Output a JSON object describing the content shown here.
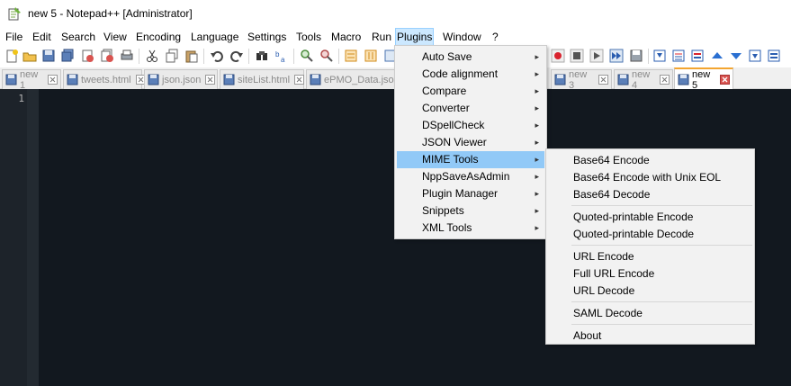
{
  "window": {
    "title": "new 5 - Notepad++ [Administrator]"
  },
  "menubar": {
    "file": "File",
    "edit": "Edit",
    "search": "Search",
    "view": "View",
    "encoding": "Encoding",
    "language": "Language",
    "settings": "Settings",
    "tools": "Tools",
    "macro": "Macro",
    "run": "Run",
    "plugins": "Plugins",
    "window": "Window",
    "help": "?"
  },
  "tabs": [
    {
      "label": "new 1"
    },
    {
      "label": "tweets.html"
    },
    {
      "label": "json.json"
    },
    {
      "label": "siteList.html"
    },
    {
      "label": "ePMO_Data.json"
    },
    {
      "label": "new 3"
    },
    {
      "label": "new 4"
    },
    {
      "label": "new 5"
    }
  ],
  "editor": {
    "line_number": "1"
  },
  "plugins_menu": {
    "items": [
      {
        "label": "Auto Save"
      },
      {
        "label": "Code alignment"
      },
      {
        "label": "Compare"
      },
      {
        "label": "Converter"
      },
      {
        "label": "DSpellCheck"
      },
      {
        "label": "JSON Viewer"
      },
      {
        "label": "MIME Tools"
      },
      {
        "label": "NppSaveAsAdmin"
      },
      {
        "label": "Plugin Manager"
      },
      {
        "label": "Snippets"
      },
      {
        "label": "XML Tools"
      }
    ],
    "highlighted": "MIME Tools"
  },
  "mime_submenu": {
    "items": [
      {
        "label": "Base64 Encode"
      },
      {
        "label": "Base64 Encode with Unix EOL"
      },
      {
        "label": "Base64 Decode"
      },
      {
        "label": "Quoted-printable Encode"
      },
      {
        "label": "Quoted-printable Decode"
      },
      {
        "label": "URL Encode"
      },
      {
        "label": "Full URL Encode"
      },
      {
        "label": "URL Decode"
      },
      {
        "label": "SAML Decode"
      },
      {
        "label": "About"
      }
    ]
  },
  "colors": {
    "editor_bg": "#12181f",
    "menu_highlight": "#91c9f7",
    "active_tab_accent": "#f3a530",
    "close_icon_red": "#d9534f"
  }
}
